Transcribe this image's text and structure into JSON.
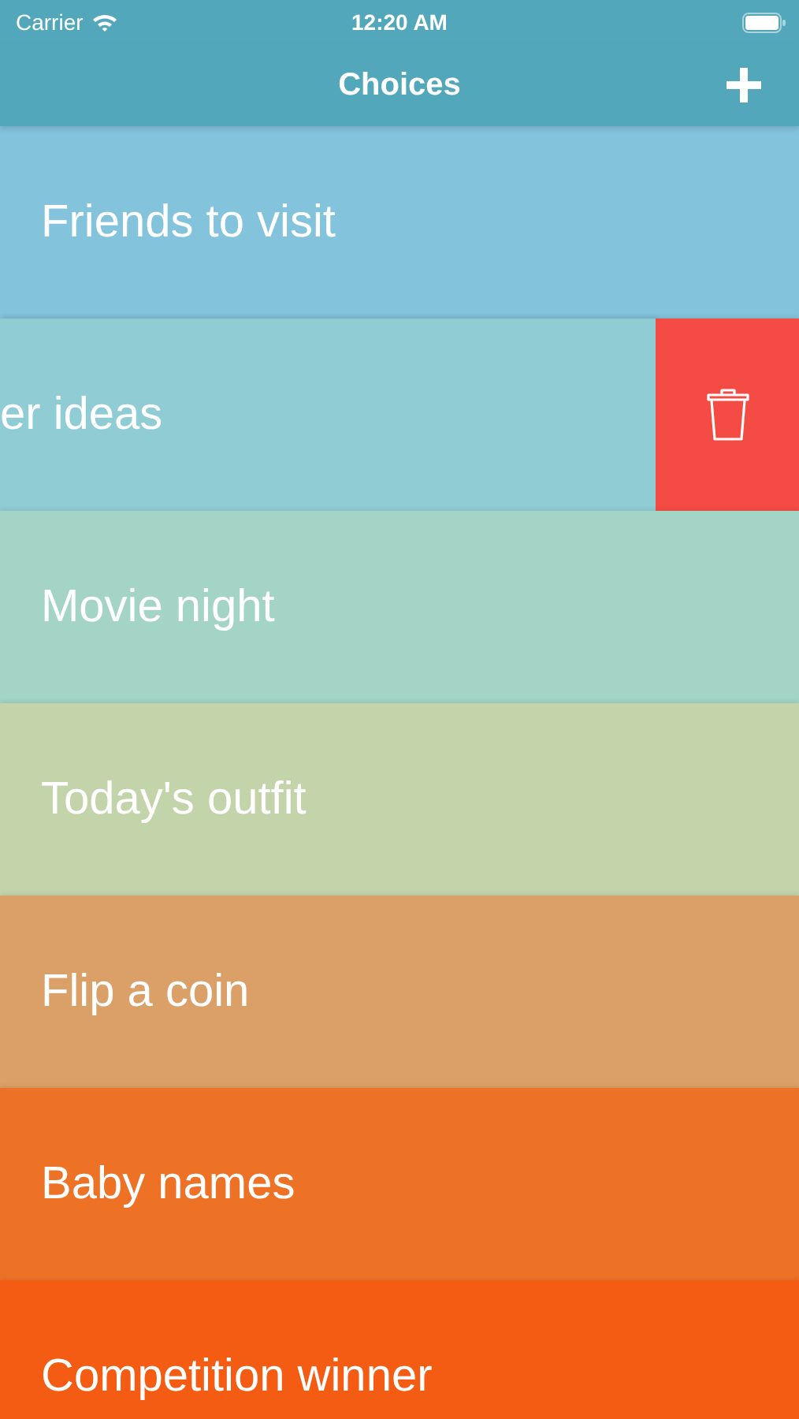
{
  "status_bar": {
    "carrier": "Carrier",
    "time": "12:20 AM"
  },
  "nav_bar": {
    "title": "Choices"
  },
  "rows": [
    {
      "label": "Friends to visit",
      "color": "#83c3dc",
      "swiped": false
    },
    {
      "label": "er ideas",
      "color": "#90ccd4",
      "swiped": true
    },
    {
      "label": "Movie night",
      "color": "#a3d4c6",
      "swiped": false
    },
    {
      "label": "Today's outfit",
      "color": "#c3d3aa",
      "swiped": false
    },
    {
      "label": "Flip a coin",
      "color": "#dba067",
      "swiped": false
    },
    {
      "label": "Baby names",
      "color": "#ee7226",
      "swiped": false
    },
    {
      "label": "Competition winner",
      "color": "#f35c12",
      "swiped": false
    }
  ]
}
